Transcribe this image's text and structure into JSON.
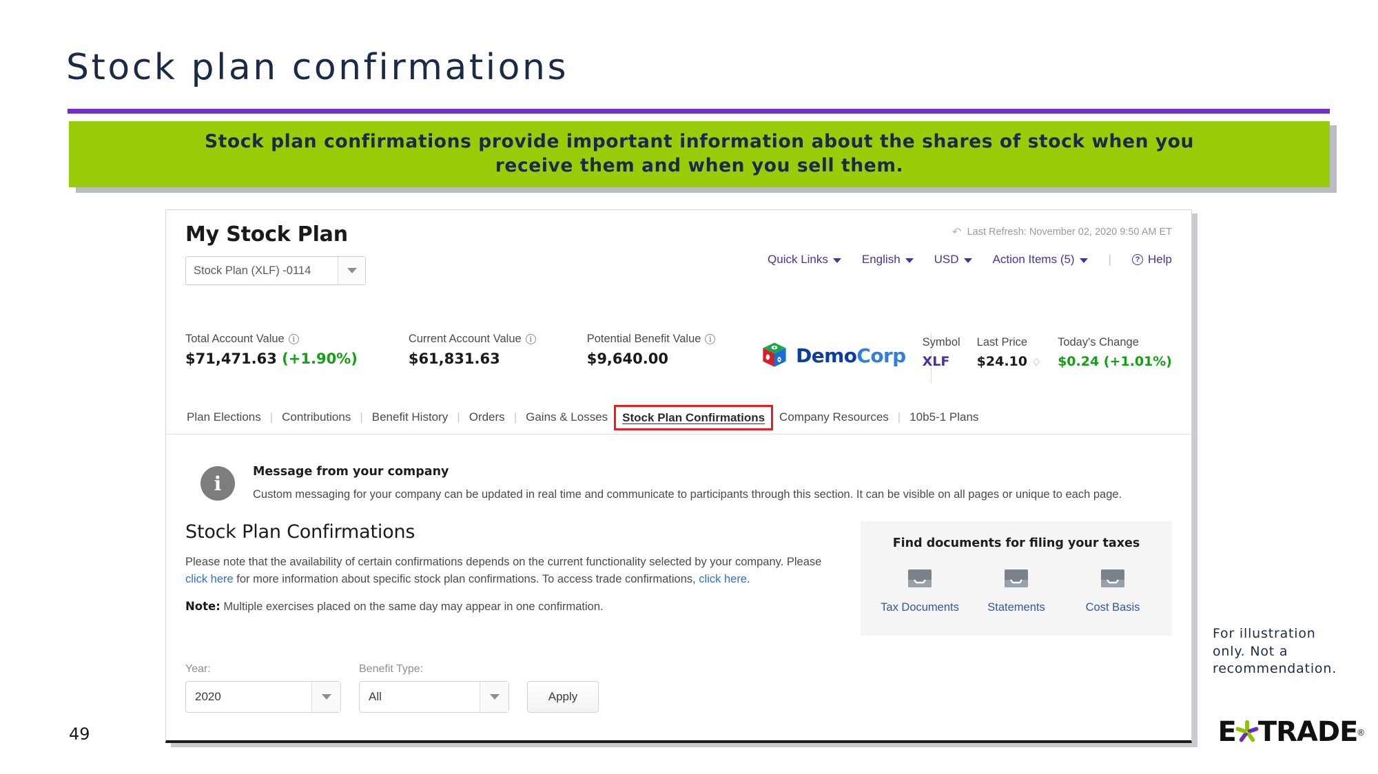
{
  "slide": {
    "title": "Stock plan confirmations",
    "banner_line1": "Stock plan confirmations provide important information about the shares of stock when you",
    "banner_line2": "receive them and when you sell them.",
    "page_number": "49",
    "disclaimer": "For illustration only. Not a recommendation.",
    "brand": {
      "e": "E",
      "trade": "TRADE",
      "reg": "®"
    },
    "colors": {
      "banner_green": "#9acd09",
      "rule_purple": "#7030c8",
      "title_navy": "#1b2a45",
      "highlight_red": "#ec1c1c",
      "link_blue": "#2f6fd0",
      "positive_green": "#12a112",
      "brand_purple": "#4b2ea8"
    }
  },
  "app": {
    "title": "My Stock Plan",
    "plan_select": {
      "value": "Stock Plan (XLF) -0114",
      "caret_icon": "chevron-down-icon"
    },
    "refresh": {
      "icon": "refresh-icon",
      "text": "Last Refresh: November 02, 2020 9:50 AM ET"
    },
    "top_nav": [
      {
        "label": "Quick Links",
        "caret": true
      },
      {
        "label": "English",
        "caret": true
      },
      {
        "label": "USD",
        "caret": true
      },
      {
        "label": "Action Items (5)",
        "caret": true
      }
    ],
    "help": {
      "label": "Help",
      "icon": "help-circle-icon"
    },
    "values": [
      {
        "label": "Total Account Value",
        "info_icon": "info-icon",
        "amount": "$71,471.63",
        "change": "(+1.90%)"
      },
      {
        "label": "Current Account Value",
        "info_icon": "info-icon",
        "amount": "$61,831.63",
        "change": ""
      },
      {
        "label": "Potential Benefit Value",
        "info_icon": "info-icon",
        "amount": "$9,640.00",
        "change": ""
      }
    ],
    "company": {
      "logo_icon": "democorp-cube-logo",
      "name_part1": "Demo",
      "name_part2": "Corp"
    },
    "ticker": [
      {
        "head": "Symbol",
        "value": "XLF",
        "style": "symbol"
      },
      {
        "head": "Last Price",
        "value": "$24.10",
        "style": "price",
        "bell_icon": "bell-icon"
      },
      {
        "head": "Today's Change",
        "value": "$0.24 (+1.01%)",
        "style": "change"
      }
    ],
    "tabs": [
      {
        "label": "Plan Elections",
        "active": false
      },
      {
        "label": "Contributions",
        "active": false
      },
      {
        "label": "Benefit History",
        "active": false
      },
      {
        "label": "Orders",
        "active": false
      },
      {
        "label": "Gains & Losses",
        "active": false
      },
      {
        "label": "Stock Plan Confirmations",
        "active": true
      },
      {
        "label": "Company Resources",
        "active": false
      },
      {
        "label": "10b5-1 Plans",
        "active": false
      }
    ],
    "message": {
      "icon": "info-icon",
      "title": "Message from your company",
      "text": "Custom messaging for your company can be updated in real time and communicate to participants through this section. It can be visible on all pages or unique to each page."
    },
    "section": {
      "title": "Stock Plan Confirmations",
      "para_a": "Please note that the availability of certain confirmations depends on the current functionality selected by your company. Please ",
      "link1": "click here",
      "para_b": " for more information about specific stock plan confirmations. To access trade confirmations, ",
      "link2": "click here",
      "para_c": ".",
      "note_label": "Note:",
      "note_text": " Multiple exercises placed on the same day may appear in one confirmation."
    },
    "docs_panel": {
      "title": "Find documents for filing your taxes",
      "items": [
        {
          "icon": "document-tray-icon",
          "label": "Tax Documents"
        },
        {
          "icon": "document-tray-icon",
          "label": "Statements"
        },
        {
          "icon": "document-tray-icon",
          "label": "Cost Basis"
        }
      ]
    },
    "filters": {
      "year": {
        "label": "Year:",
        "value": "2020"
      },
      "benefit_type": {
        "label": "Benefit Type:",
        "value": "All"
      },
      "apply_label": "Apply"
    }
  }
}
